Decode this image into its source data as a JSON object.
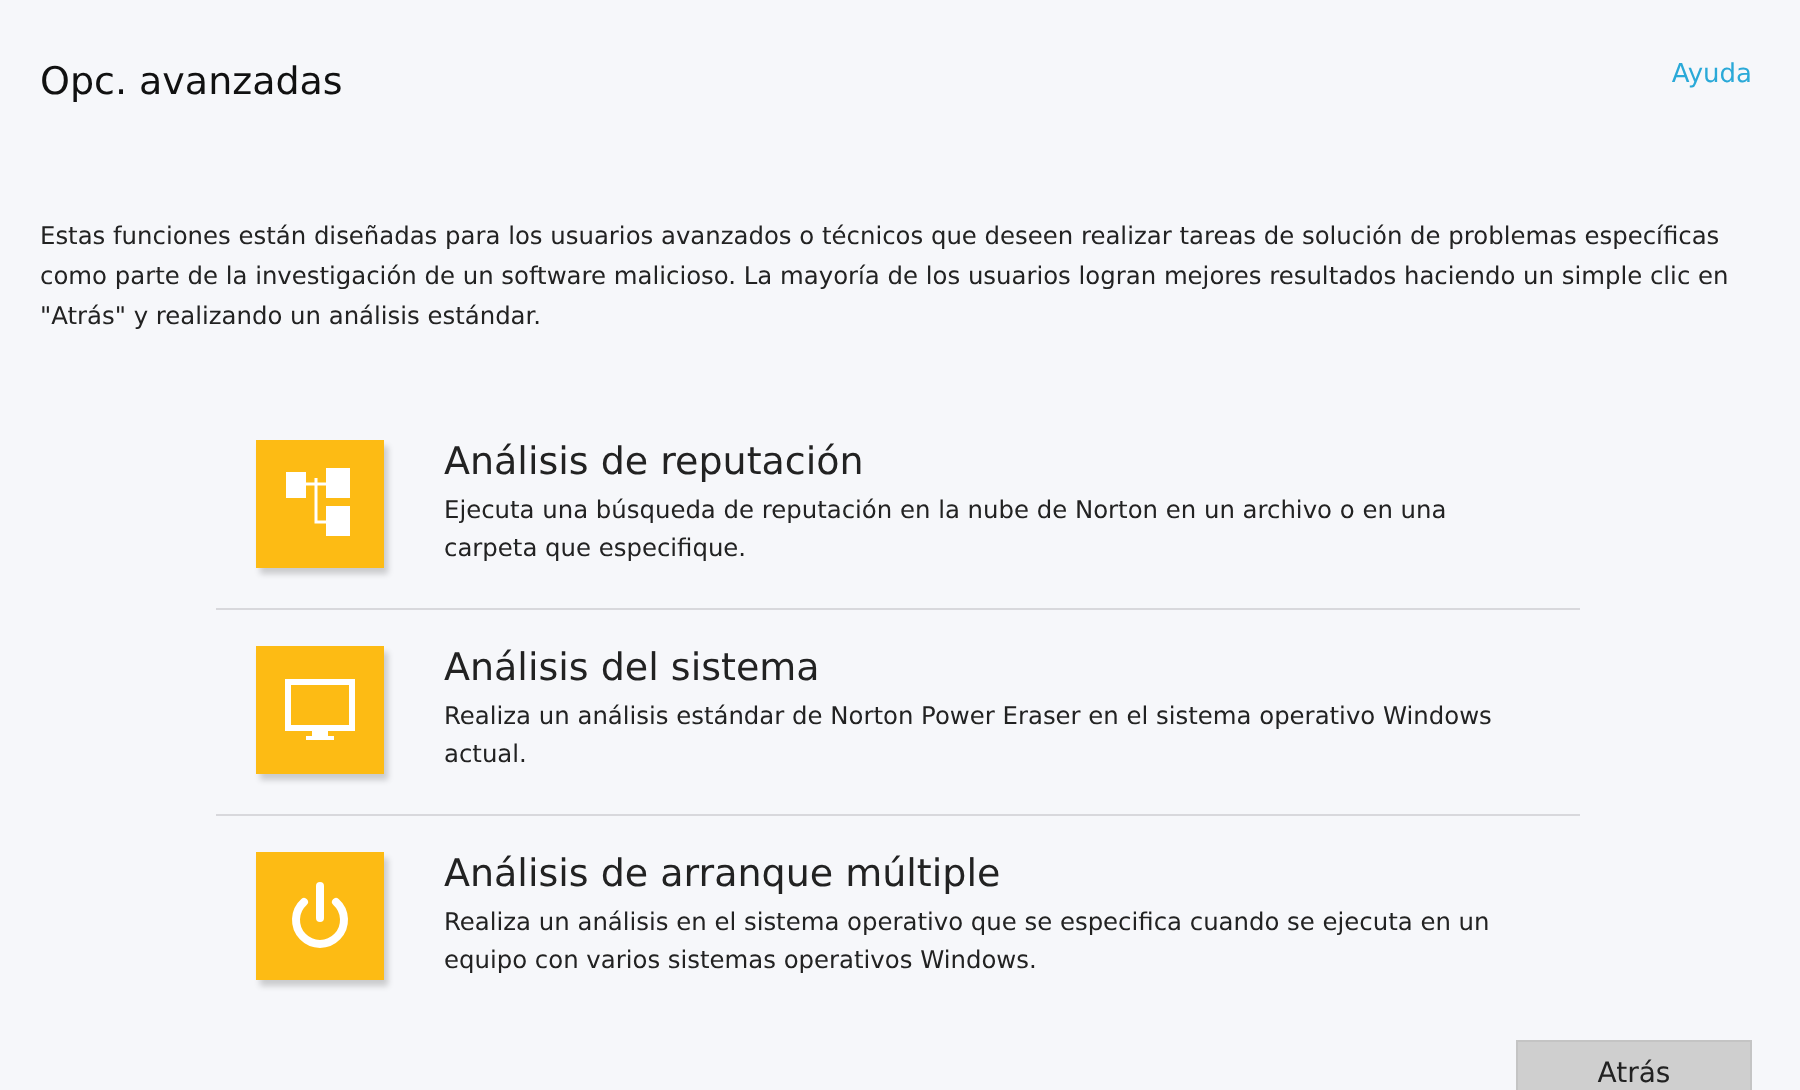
{
  "header": {
    "title": "Opc. avanzadas",
    "help_link": "Ayuda"
  },
  "description": "Estas funciones están diseñadas para los usuarios avanzados o técnicos que deseen realizar tareas de solución de problemas específicas como parte de la investigación de un software malicioso. La mayoría de los usuarios logran mejores resultados haciendo un simple clic en \"Atrás\" y realizando un análisis estándar.",
  "options": [
    {
      "kind": "tree",
      "title": "Análisis de reputación",
      "description": "Ejecuta una búsqueda de reputación en la nube de Norton en un archivo o en una carpeta que especifique."
    },
    {
      "kind": "monitor",
      "title": "Análisis del sistema",
      "description": "Realiza un análisis estándar de Norton Power Eraser en el sistema operativo Windows actual."
    },
    {
      "kind": "power",
      "title": "Análisis de arranque múltiple",
      "description": "Realiza un análisis en el sistema operativo que se especifica cuando se ejecuta en un equipo con varios sistemas operativos Windows."
    }
  ],
  "back_button": "Atrás"
}
